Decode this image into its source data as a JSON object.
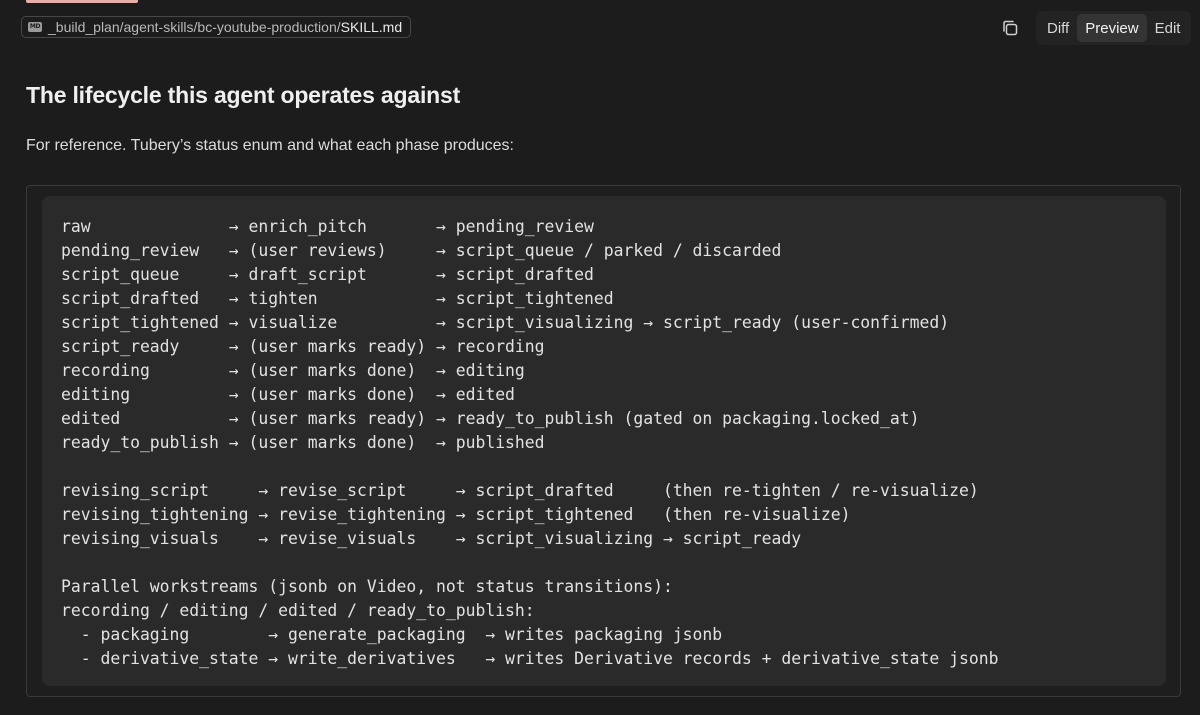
{
  "file_path": {
    "directory": "_build_plan/agent-skills/bc-youtube-production/",
    "file": "SKILL.md",
    "icon": "markdown-icon",
    "icon_text": "MD"
  },
  "toolbar": {
    "copy_icon": "copy-icon",
    "tabs": [
      {
        "label": "Diff",
        "active": false
      },
      {
        "label": "Preview",
        "active": true
      },
      {
        "label": "Edit",
        "active": false
      }
    ]
  },
  "document": {
    "heading": "The lifecycle this agent operates against",
    "intro": "For reference. Tubery’s status enum and what each phase produces:",
    "code_lines": [
      "raw              → enrich_pitch       → pending_review",
      "pending_review   → (user reviews)     → script_queue / parked / discarded",
      "script_queue     → draft_script       → script_drafted",
      "script_drafted   → tighten            → script_tightened",
      "script_tightened → visualize          → script_visualizing → script_ready (user-confirmed)",
      "script_ready     → (user marks ready) → recording",
      "recording        → (user marks done)  → editing",
      "editing          → (user marks done)  → edited",
      "edited           → (user marks ready) → ready_to_publish (gated on packaging.locked_at)",
      "ready_to_publish → (user marks done)  → published",
      "",
      "revising_script     → revise_script     → script_drafted     (then re-tighten / re-visualize)",
      "revising_tightening → revise_tightening → script_tightened   (then re-visualize)",
      "revising_visuals    → revise_visuals    → script_visualizing → script_ready",
      "",
      "Parallel workstreams (jsonb on Video, not status transitions):",
      "recording / editing / edited / ready_to_publish:",
      "  - packaging        → generate_packaging  → writes packaging jsonb",
      "  - derivative_state → write_derivatives   → writes Derivative records + derivative_state jsonb"
    ]
  },
  "colors": {
    "background": "#1c1c1c",
    "code_background": "#2a2a2a",
    "accent": "#e6b0a8"
  }
}
